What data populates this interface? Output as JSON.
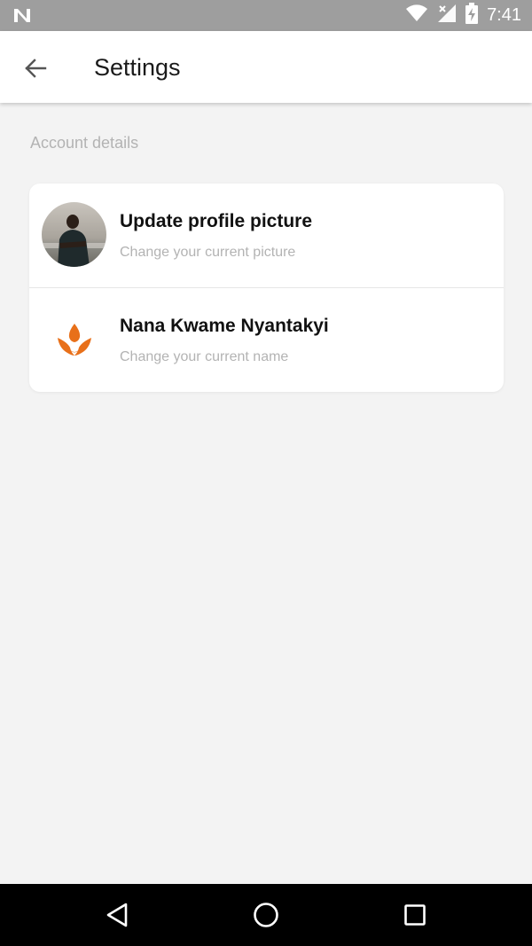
{
  "status_bar": {
    "time": "7:41",
    "icons": [
      "n-notification-icon",
      "wifi-icon",
      "no-signal-icon",
      "battery-charging-icon"
    ]
  },
  "app_bar": {
    "title": "Settings",
    "back_icon": "arrow-left-icon"
  },
  "section": {
    "label": "Account details"
  },
  "items": [
    {
      "title": "Update profile picture",
      "subtitle": "Change your current picture",
      "icon": "profile-photo"
    },
    {
      "title": "Nana Kwame Nyantakyi",
      "subtitle": "Change your current name",
      "icon": "brand-flame-icon"
    }
  ],
  "colors": {
    "accent": "#e8701a",
    "status_bar": "#9e9e9e",
    "background": "#f3f3f3"
  },
  "nav_bar": {
    "icons": [
      "triangle-back-icon",
      "circle-home-icon",
      "square-recents-icon"
    ]
  }
}
